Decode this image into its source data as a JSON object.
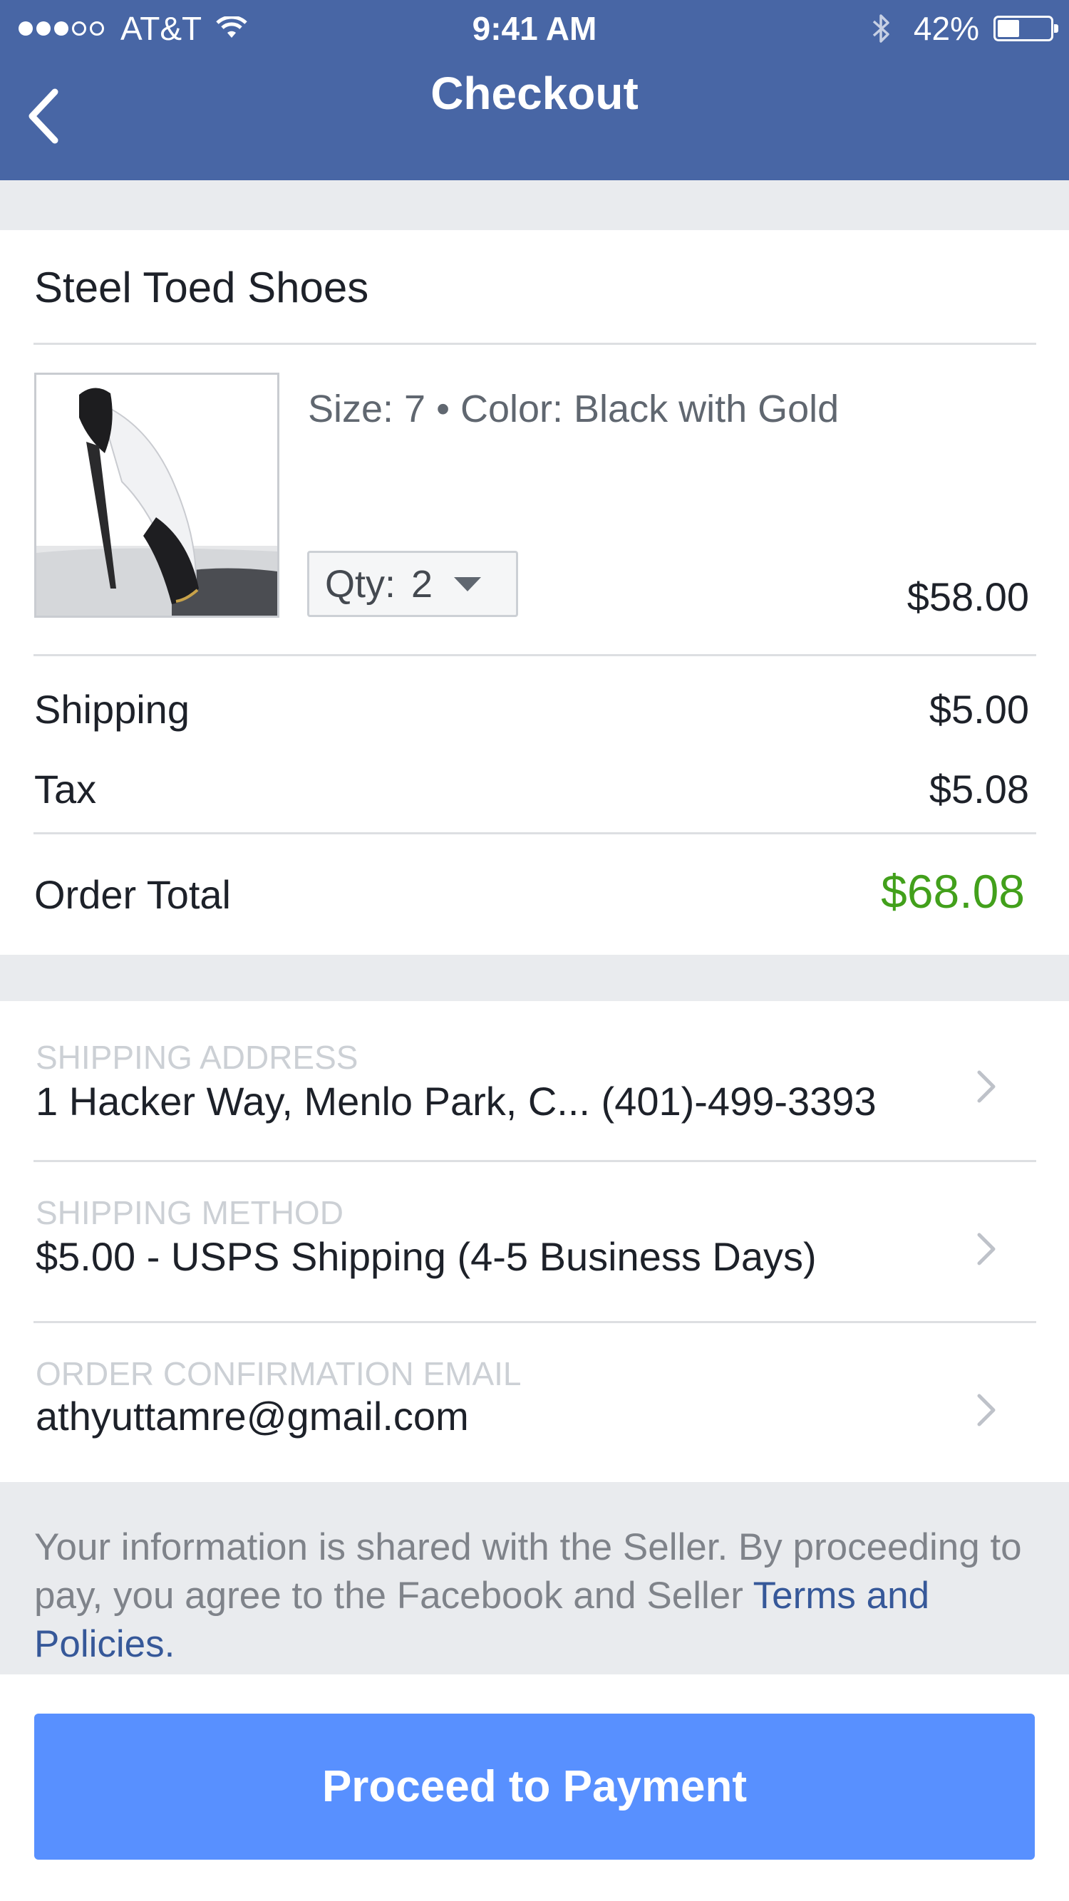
{
  "status_bar": {
    "carrier": "AT&T",
    "signal_bars_filled": 3,
    "signal_bars_total": 5,
    "time": "9:41 AM",
    "battery_percent": "42%",
    "battery_level": 0.42
  },
  "nav": {
    "title": "Checkout"
  },
  "product": {
    "title": "Steel Toed Shoes",
    "variant": "Size: 7 • Color: Black with Gold",
    "qty_label": "Qty:",
    "qty_value": "2",
    "price": "$58.00"
  },
  "summary": {
    "shipping_label": "Shipping",
    "shipping_value": "$5.00",
    "tax_label": "Tax",
    "tax_value": "$5.08",
    "total_label": "Order Total",
    "total_value": "$68.08"
  },
  "details": {
    "shipping_address_label": "SHIPPING ADDRESS",
    "shipping_address_value": "1 Hacker Way, Menlo Park, C... (401)-499-3393",
    "shipping_method_label": "SHIPPING METHOD",
    "shipping_method_value": "$5.00 - USPS Shipping (4-5 Business Days)",
    "email_label": "ORDER CONFIRMATION EMAIL",
    "email_value": "athyuttamre@gmail.com"
  },
  "disclaimer": {
    "text": "Your information is shared with the Seller. By proceeding to pay, you agree to the Facebook and Seller ",
    "link": "Terms and Policies."
  },
  "footer": {
    "button_label": "Proceed to Payment"
  },
  "colors": {
    "header": "#4866a5",
    "total": "#42a01b",
    "button": "#5890ff",
    "link": "#365899",
    "background": "#e9ebee"
  },
  "icons": [
    "back-chevron-icon",
    "wifi-icon",
    "bluetooth-icon",
    "battery-icon",
    "dropdown-caret-icon",
    "chevron-right-icon"
  ]
}
